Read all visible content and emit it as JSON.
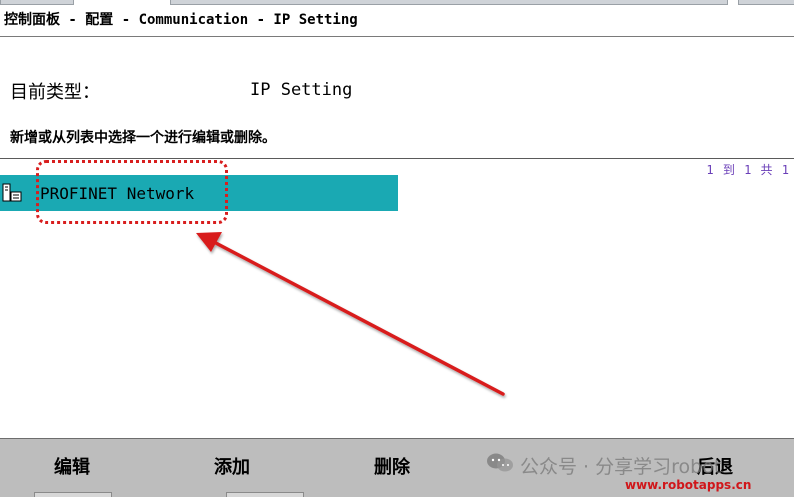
{
  "header": {
    "breadcrumb": "控制面板 - 配置 - Communication - IP Setting"
  },
  "form": {
    "type_label": "目前类型：",
    "type_value": "IP Setting",
    "instruction": "新增或从列表中选择一个进行编辑或删除。"
  },
  "list": {
    "pager": "1 到 1 共 1",
    "items": [
      {
        "label": "PROFINET Network",
        "icon": "network-config-icon"
      }
    ]
  },
  "softkeys": {
    "edit": "编辑",
    "add": "添加",
    "delete": "删除",
    "back": "后退"
  },
  "watermark": {
    "text": "公众号 · 分享学习robot",
    "icon": "wechat-icon",
    "url": "www.robotapps.cn"
  },
  "colors": {
    "selection": "#1aa9b3",
    "annotation": "#d81e1e",
    "pager": "#6a3fb8",
    "softkey_bar": "#bdbdbd"
  }
}
